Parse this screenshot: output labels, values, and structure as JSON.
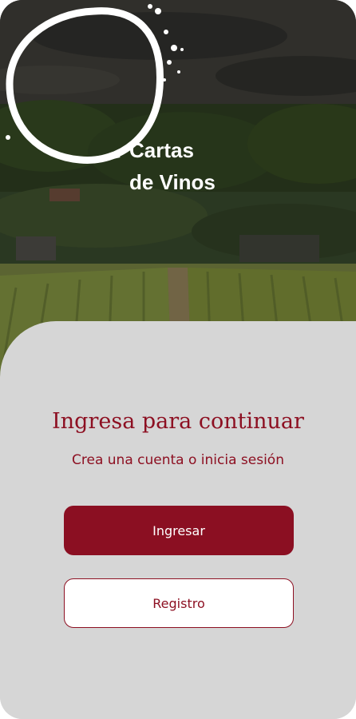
{
  "logo": {
    "line1": "Cartas",
    "line2": "de Vinos"
  },
  "login": {
    "title": "Ingresa para continuar",
    "subtitle": "Crea una cuenta o inicia sesión"
  },
  "buttons": {
    "primary_label": "Ingresar",
    "secondary_label": "Registro"
  },
  "colors": {
    "brand": "#8b0f22",
    "sheet": "#d6d6d6"
  }
}
